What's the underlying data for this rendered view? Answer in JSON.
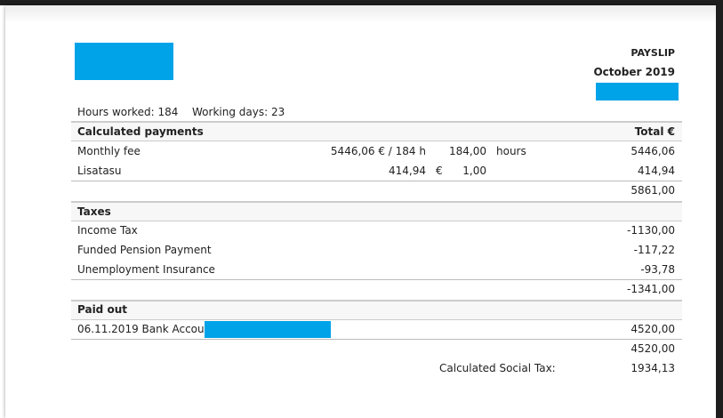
{
  "header": {
    "title": "PAYSLIP",
    "period": "October 2019"
  },
  "summary": {
    "hours_worked": "Hours worked: 184",
    "working_days": "Working days: 23"
  },
  "calculated": {
    "title": "Calculated payments",
    "total_label": "Total €",
    "rows": [
      {
        "name": "Monthly fee",
        "rate": "5446,06 € / 184 h",
        "unit_sym": "",
        "qty": "184,00",
        "unit": "hours",
        "total": "5446,06"
      },
      {
        "name": "Lisatasu",
        "rate": "414,94",
        "unit_sym": "€",
        "qty": "1,00",
        "unit": "",
        "total": "414,94"
      }
    ],
    "subtotal": "5861,00"
  },
  "taxes": {
    "title": "Taxes",
    "rows": [
      {
        "name": "Income Tax",
        "total": "-1130,00"
      },
      {
        "name": "Funded Pension Payment",
        "total": "-117,22"
      },
      {
        "name": "Unemployment Insurance",
        "total": "-93,78"
      }
    ],
    "subtotal": "-1341,00"
  },
  "paid_out": {
    "title": "Paid out",
    "rows": [
      {
        "name": "06.11.2019 Bank Account",
        "total": "4520,00"
      }
    ],
    "subtotal": "4520,00"
  },
  "social_tax": {
    "label": "Calculated Social Tax:",
    "value": "1934,13"
  }
}
